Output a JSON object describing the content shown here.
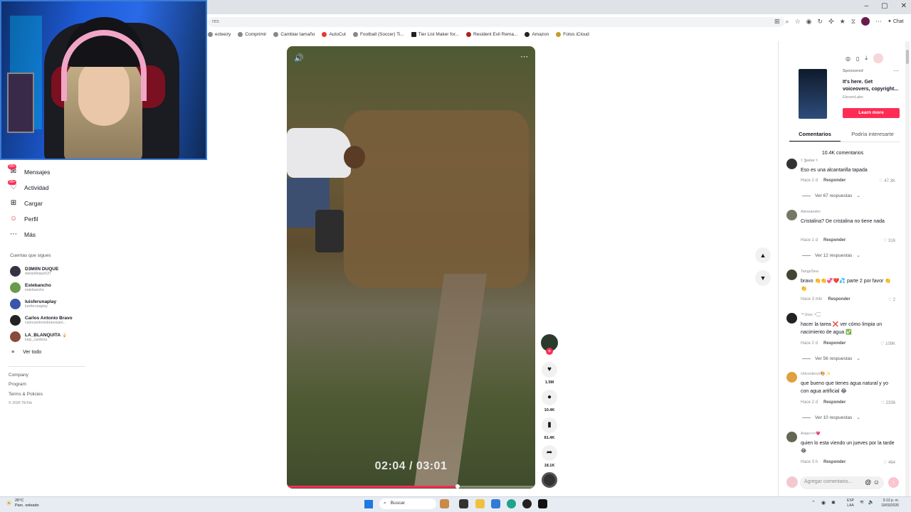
{
  "browser": {
    "url_fragment": "res",
    "window_controls": [
      "–",
      "▢",
      "✕"
    ],
    "chat_label": "Chat",
    "bookmarks": [
      {
        "label": "ecteezy",
        "icon": "bookmark-icon"
      },
      {
        "label": "Comprimir",
        "icon": "bookmark-icon"
      },
      {
        "label": "Cambiar tamaño",
        "icon": "globe-icon"
      },
      {
        "label": "AutoCut",
        "icon": "bookmark-icon"
      },
      {
        "label": "Football (Soccer) Ti...",
        "icon": "globe-icon"
      },
      {
        "label": "Tier List Maker for...",
        "icon": "bookmark-icon"
      },
      {
        "label": "Resident Evil Rema...",
        "icon": "bookmark-icon"
      },
      {
        "label": "Amazon",
        "icon": "amazon-icon"
      },
      {
        "label": "Fotos iCloud",
        "icon": "cloud-icon"
      }
    ]
  },
  "sidebar": {
    "nav": [
      {
        "label": "Mensajes",
        "icon": "messages-icon",
        "badge": "99+"
      },
      {
        "label": "Actividad",
        "icon": "activity-icon",
        "badge": "99+"
      },
      {
        "label": "Cargar",
        "icon": "upload-icon",
        "badge": ""
      },
      {
        "label": "Perfil",
        "icon": "profile-icon",
        "badge": ""
      },
      {
        "label": "Más",
        "icon": "more-icon",
        "badge": ""
      }
    ],
    "following_title": "Cuentas que sigues",
    "accounts": [
      {
        "name": "D3M0N DUQUE",
        "handle": "danieldoque637"
      },
      {
        "name": "Estebancho",
        "handle": "estebancho"
      },
      {
        "name": "luisferunaplay",
        "handle": "luisferunaplay"
      },
      {
        "name": "Carlos Antonio Bravo",
        "handle": "carlosantoniobravosant..."
      },
      {
        "name": "LA_BLANQUITA 🍦",
        "handle": "katy_cardona"
      }
    ],
    "see_all": "Ver todo",
    "footer": [
      "Company",
      "Program",
      "Terms & Policies"
    ],
    "copyright": "© 2026 TikTok"
  },
  "video": {
    "time": "02:04 / 03:01",
    "progress": 0.687
  },
  "actions": {
    "likes": "1.5M",
    "comments": "10.4K",
    "saves": "81.4K",
    "shares": "18.1K"
  },
  "ad": {
    "sponsored": "Sponsored",
    "title": "It's here. Get voiceovers, copyright...",
    "brand": "ElevenLabs",
    "cta": "Learn more"
  },
  "tabs": {
    "comments": "Comentarios",
    "related": "Podría interesarte"
  },
  "comments_count": "10.4K comentarios",
  "comments": [
    {
      "user": "⚕ 𝕵𝖚𝖓𝖎𝖔𝖗 ⚕",
      "text": "Eso es una alcantarilla tapada",
      "time": "Hace 2 d",
      "reply": "Responder",
      "likes": "47.3K",
      "replies": "Ver 67 respuestas"
    },
    {
      "user": "Alessandro",
      "text": "Cristalina? De cristalina no tiene nada",
      "time": "Hace 1 d",
      "reply": "Responder",
      "likes": "316",
      "replies": "Ver 12 respuestas"
    },
    {
      "user": "TangoSea",
      "text": "bravo 👏👏💞❤️💦 parte 2 por favor 👏👏",
      "time": "Hace 3 min",
      "reply": "Responder",
      "likes": "2",
      "replies": ""
    },
    {
      "user": "™Joss ⚡🏻",
      "text": "hacer la tarea ❌ ver cómo limpia un nacimiento de agua ✅",
      "time": "Hace 2 d",
      "reply": "Responder",
      "likes": "109K",
      "replies": "Ver 56 respuestas"
    },
    {
      "user": "chicoxlervo🎨 ✨",
      "text": "que bueno que tienes agua natural y yo con agua artificial 😂",
      "time": "Hace 2 d",
      "reply": "Responder",
      "likes": "2336",
      "replies": "Ver 10 respuestas"
    },
    {
      "user": "Araa>>>💗",
      "text": "quien lo esta viendo un jueves por la tarde 😂",
      "time": "Hace 3 h",
      "reply": "Responder",
      "likes": "464",
      "replies": ""
    }
  ],
  "composer": {
    "placeholder": "Agregar comentario..."
  },
  "taskbar": {
    "temp": "26°C",
    "weather": "Parc. soleado",
    "search": "Buscar",
    "lang1": "ESP",
    "lang2": "LAA",
    "time": "5:13 p. m.",
    "date": "19/03/2026"
  }
}
